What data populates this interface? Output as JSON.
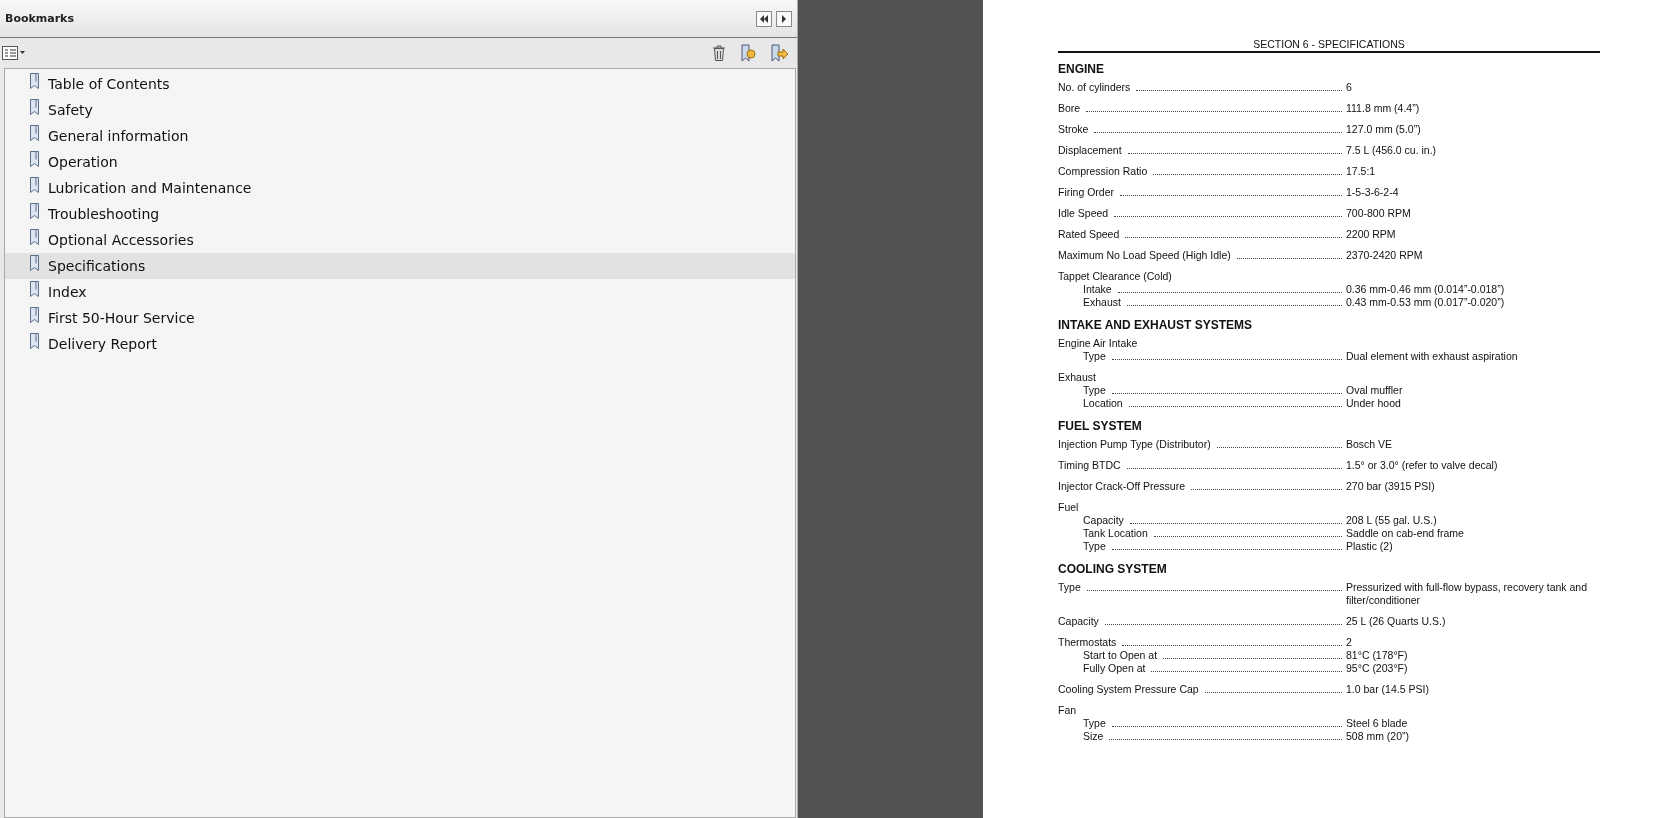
{
  "bookmarks_panel": {
    "title": "Bookmarks",
    "items": [
      {
        "label": "Table of Contents",
        "selected": false
      },
      {
        "label": "Safety",
        "selected": false
      },
      {
        "label": "General information",
        "selected": false
      },
      {
        "label": "Operation",
        "selected": false
      },
      {
        "label": "Lubrication and Maintenance",
        "selected": false
      },
      {
        "label": "Troubleshooting",
        "selected": false
      },
      {
        "label": "Optional Accessories",
        "selected": false
      },
      {
        "label": "Specifications",
        "selected": true
      },
      {
        "label": "Index",
        "selected": false
      },
      {
        "label": "First 50-Hour Service",
        "selected": false
      },
      {
        "label": "Delivery Report",
        "selected": false
      }
    ]
  },
  "document": {
    "header": "SECTION 6 - SPECIFICATIONS",
    "sections": [
      {
        "title": "ENGINE",
        "entries": [
          {
            "label": "No. of cylinders",
            "value": "6"
          },
          {
            "label": "Bore",
            "value": "111.8 mm (4.4”)"
          },
          {
            "label": "Stroke",
            "value": "127.0 mm (5.0”)"
          },
          {
            "label": "Displacement",
            "value": "7.5 L (456.0 cu. in.)"
          },
          {
            "label": "Compression Ratio",
            "value": "17.5:1"
          },
          {
            "label": "Firing Order",
            "value": "1-5-3-6-2-4"
          },
          {
            "label": "Idle Speed",
            "value": "700-800 RPM"
          },
          {
            "label": "Rated Speed",
            "value": "2200 RPM"
          },
          {
            "label": "Maximum No Load Speed (High Idle)",
            "value": "2370-2420 RPM"
          },
          {
            "label": "Tappet Clearance (Cold)",
            "children": [
              {
                "label": "Intake",
                "value": "0.36 mm-0.46 mm (0.014”-0.018”)"
              },
              {
                "label": "Exhaust",
                "value": "0.43 mm-0.53 mm (0.017”-0.020”)"
              }
            ]
          }
        ]
      },
      {
        "title": "INTAKE AND EXHAUST SYSTEMS",
        "entries": [
          {
            "label": "Engine Air Intake",
            "children": [
              {
                "label": "Type",
                "value": "Dual element with exhaust aspiration"
              }
            ]
          },
          {
            "label": "Exhaust",
            "children": [
              {
                "label": "Type",
                "value": "Oval muffler"
              },
              {
                "label": "Location",
                "value": "Under hood"
              }
            ]
          }
        ]
      },
      {
        "title": "FUEL SYSTEM",
        "entries": [
          {
            "label": "Injection Pump Type (Distributor)",
            "value": "Bosch VE"
          },
          {
            "label": "Timing BTDC",
            "value": "1.5° or 3.0° (refer to valve decal)"
          },
          {
            "label": "Injector Crack-Off Pressure",
            "value": "270 bar (3915 PSI)"
          },
          {
            "label": "Fuel",
            "children": [
              {
                "label": "Capacity",
                "value": "208 L (55 gal. U.S.)"
              },
              {
                "label": "Tank Location",
                "value": "Saddle on cab-end frame"
              },
              {
                "label": "Type",
                "value": "Plastic (2)"
              }
            ]
          }
        ]
      },
      {
        "title": "COOLING SYSTEM",
        "entries": [
          {
            "label": "Type",
            "value": "Pressurized with full-flow bypass, recovery tank and filter/conditioner"
          },
          {
            "label": "Capacity",
            "value": "25 L (26 Quarts U.S.)"
          },
          {
            "label": "Thermostats",
            "value": "2",
            "children": [
              {
                "label": "Start to Open at",
                "value": "81°C (178°F)"
              },
              {
                "label": "Fully Open at",
                "value": "95°C (203°F)"
              }
            ]
          },
          {
            "label": "Cooling System Pressure Cap",
            "value": "1.0 bar (14.5 PSI)"
          },
          {
            "label": "Fan",
            "children": [
              {
                "label": "Type",
                "value": "Steel 6 blade"
              },
              {
                "label": "Size",
                "value": "508 mm (20”)"
              }
            ]
          }
        ]
      }
    ]
  }
}
